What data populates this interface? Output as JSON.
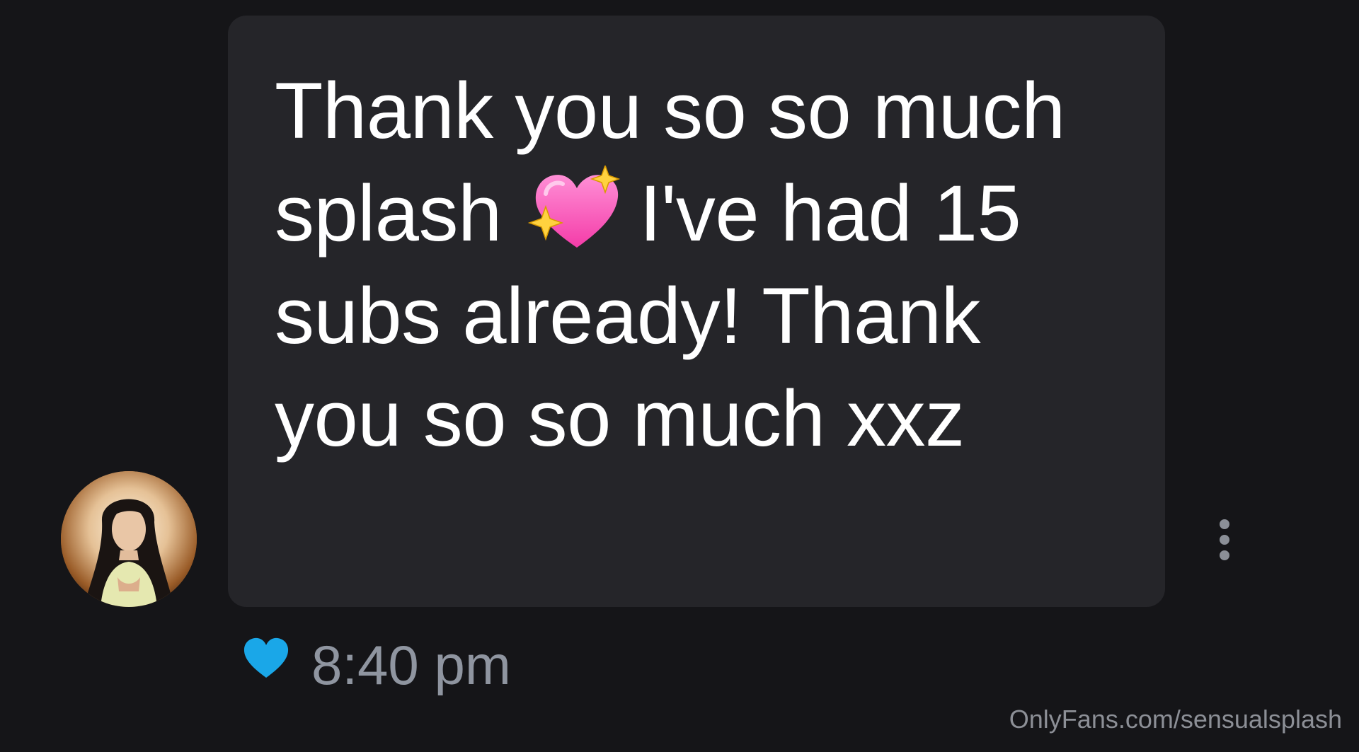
{
  "chat": {
    "message": {
      "text_before_emoji": "Thank you so so much splash",
      "emoji": "sparkling-heart-emoji",
      "text_after_emoji": "I've had 15 subs already! Thank you so so much xxz"
    },
    "timestamp": "8:40 pm",
    "like_state": "liked",
    "colors": {
      "background": "#151518",
      "bubble": "#252529",
      "message_text": "#ffffff",
      "timestamp_text": "#8f95a0",
      "like_heart": "#1aa7e8",
      "emoji_heart": "#ff5fc3",
      "emoji_sparkle": "#ffd23f"
    }
  },
  "watermark": {
    "text": "OnlyFans.com/sensualsplash"
  }
}
